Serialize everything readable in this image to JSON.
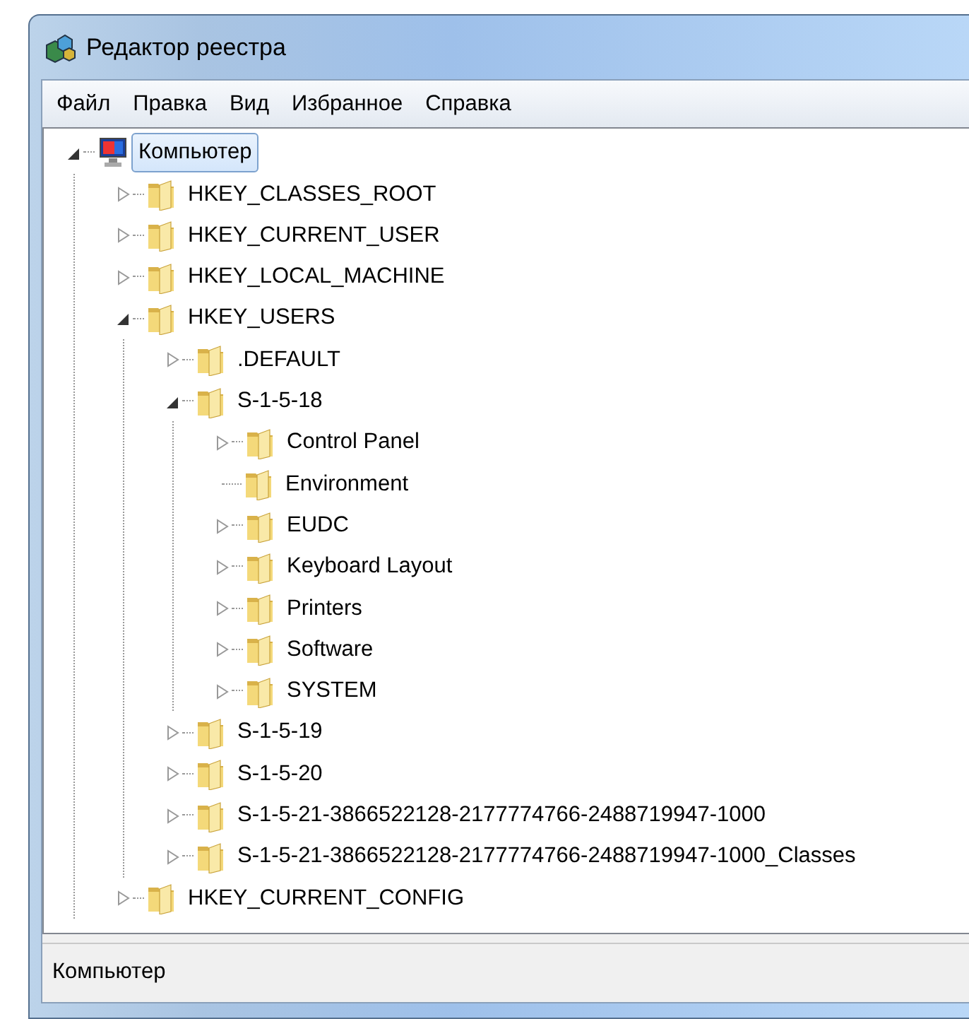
{
  "window": {
    "title": "Редактор реестра"
  },
  "menu": [
    {
      "label": "Файл"
    },
    {
      "label": "Правка"
    },
    {
      "label": "Вид"
    },
    {
      "label": "Избранное"
    },
    {
      "label": "Справка"
    }
  ],
  "tree": [
    {
      "kind": "computer",
      "label": "Компьютер",
      "selected": true,
      "expanded": true,
      "children": [
        {
          "kind": "key",
          "label": "HKEY_CLASSES_ROOT",
          "selected": false,
          "expanded": false
        },
        {
          "kind": "key",
          "label": "HKEY_CURRENT_USER",
          "selected": false,
          "expanded": false
        },
        {
          "kind": "key",
          "label": "HKEY_LOCAL_MACHINE",
          "selected": false,
          "expanded": false
        },
        {
          "kind": "key",
          "label": "HKEY_USERS",
          "selected": false,
          "expanded": true,
          "children": [
            {
              "kind": "key",
              "label": ".DEFAULT",
              "selected": false,
              "expanded": false
            },
            {
              "kind": "key",
              "label": "S-1-5-18",
              "selected": false,
              "expanded": true,
              "children": [
                {
                  "kind": "key",
                  "label": "Control Panel",
                  "selected": false,
                  "expanded": false
                },
                {
                  "kind": "leaf",
                  "label": "Environment",
                  "selected": false
                },
                {
                  "kind": "key",
                  "label": "EUDC",
                  "selected": false,
                  "expanded": false
                },
                {
                  "kind": "key",
                  "label": "Keyboard Layout",
                  "selected": false,
                  "expanded": false
                },
                {
                  "kind": "key",
                  "label": "Printers",
                  "selected": false,
                  "expanded": false
                },
                {
                  "kind": "key",
                  "label": "Software",
                  "selected": false,
                  "expanded": false
                },
                {
                  "kind": "key",
                  "label": "SYSTEM",
                  "selected": false,
                  "expanded": false
                }
              ]
            },
            {
              "kind": "key",
              "label": "S-1-5-19",
              "selected": false,
              "expanded": false
            },
            {
              "kind": "key",
              "label": "S-1-5-20",
              "selected": false,
              "expanded": false
            },
            {
              "kind": "key",
              "label": "S-1-5-21-3866522128-2177774766-2488719947-1000",
              "selected": false,
              "expanded": false
            },
            {
              "kind": "key",
              "label": "S-1-5-21-3866522128-2177774766-2488719947-1000_Classes",
              "selected": false,
              "expanded": false
            }
          ]
        },
        {
          "kind": "key",
          "label": "HKEY_CURRENT_CONFIG",
          "selected": false,
          "expanded": false
        }
      ]
    }
  ],
  "status_bar": {
    "text": "Компьютер"
  }
}
